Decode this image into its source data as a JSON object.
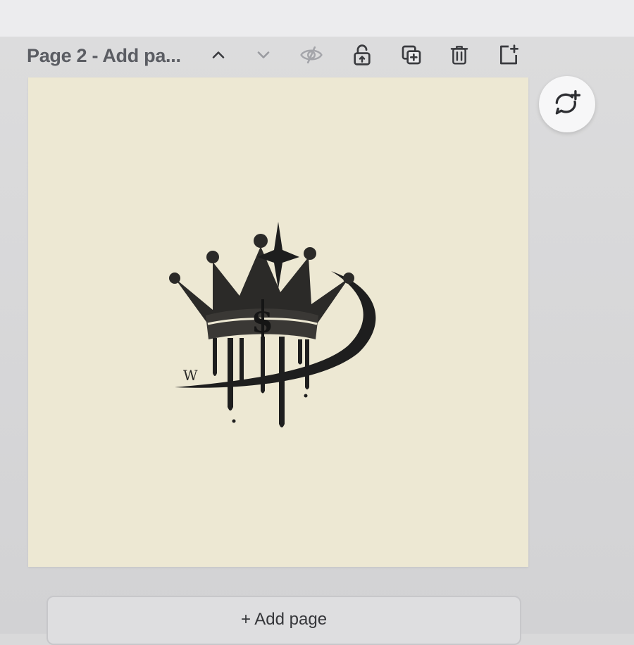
{
  "header": {
    "page_title": "Page 2 - Add pa...",
    "buttons": [
      {
        "name": "move-page-up",
        "icon": "chevron-up-icon"
      },
      {
        "name": "move-page-down",
        "icon": "chevron-down-icon"
      },
      {
        "name": "hide-page",
        "icon": "eye-off-icon"
      },
      {
        "name": "lock-page",
        "icon": "unlock-icon"
      },
      {
        "name": "duplicate-page",
        "icon": "duplicate-icon"
      },
      {
        "name": "delete-page",
        "icon": "trash-icon"
      },
      {
        "name": "add-page",
        "icon": "add-page-icon"
      }
    ]
  },
  "canvas": {
    "background": "#ede8d3",
    "logo": {
      "letter": "W",
      "ink_color": "#1e1e1e"
    }
  },
  "comment": {
    "icon": "add-comment-icon"
  },
  "footer": {
    "add_page_label": "+ Add page"
  }
}
